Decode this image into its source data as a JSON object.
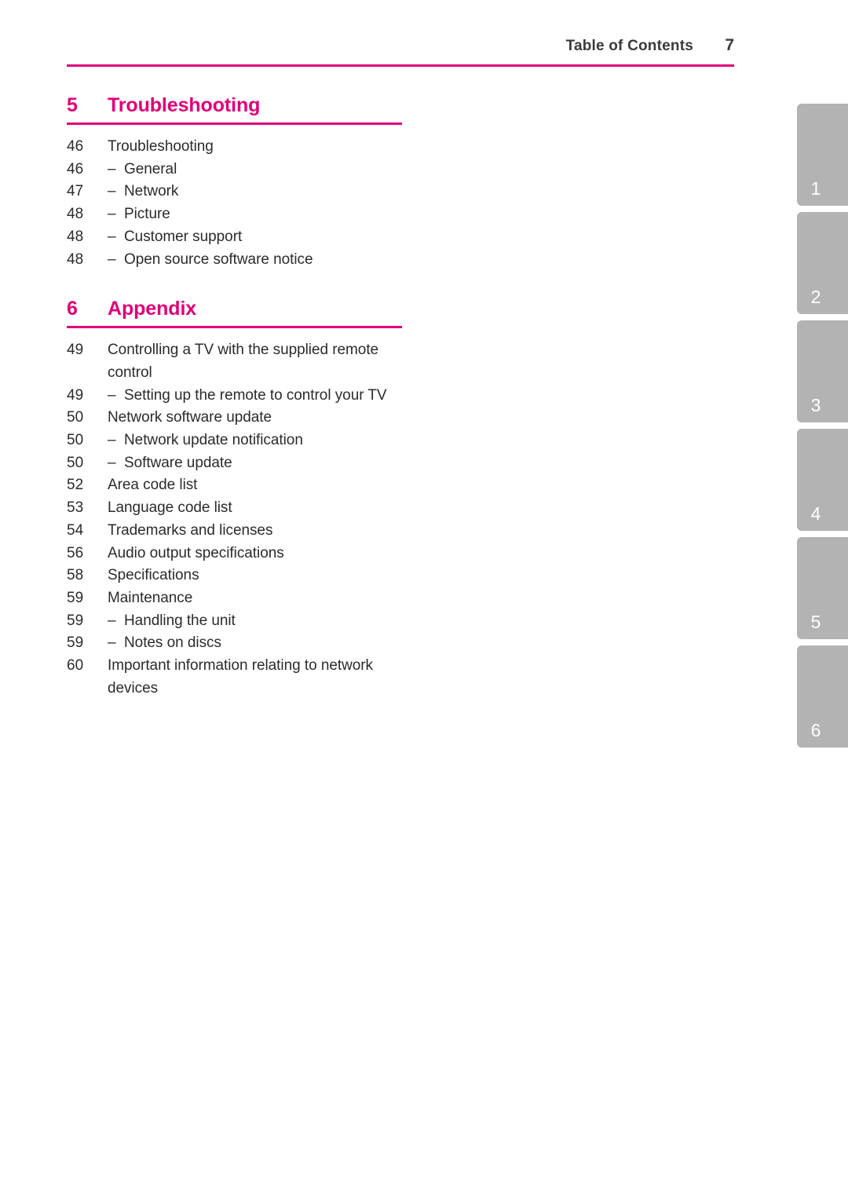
{
  "header": {
    "title": "Table of Contents",
    "page_number": "7",
    "rule_color": "#e0007a"
  },
  "theme": {
    "accent_color": "#e0007a",
    "text_color": "#2b2b2b",
    "tab_color": "#b3b3b3",
    "tab_label_color": "#ffffff"
  },
  "chapters": [
    {
      "number": "5",
      "title": "Troubleshooting",
      "entries": [
        {
          "page": "46",
          "dash": "",
          "text": "Troubleshooting",
          "level": 1
        },
        {
          "page": "46",
          "dash": "–",
          "text": "General",
          "level": 2
        },
        {
          "page": "47",
          "dash": "–",
          "text": "Network",
          "level": 2
        },
        {
          "page": "48",
          "dash": "–",
          "text": "Picture",
          "level": 2
        },
        {
          "page": "48",
          "dash": "–",
          "text": "Customer support",
          "level": 2
        },
        {
          "page": "48",
          "dash": "–",
          "text": "Open source software notice",
          "level": 2
        }
      ]
    },
    {
      "number": "6",
      "title": "Appendix",
      "entries": [
        {
          "page": "49",
          "dash": "",
          "text": "Controlling a TV with the supplied remote control",
          "level": 1
        },
        {
          "page": "49",
          "dash": "–",
          "text": "Setting up the remote to control your TV",
          "level": 2
        },
        {
          "page": "50",
          "dash": "",
          "text": "Network software update",
          "level": 1
        },
        {
          "page": "50",
          "dash": "–",
          "text": "Network update notification",
          "level": 2
        },
        {
          "page": "50",
          "dash": "–",
          "text": "Software update",
          "level": 2
        },
        {
          "page": "52",
          "dash": "",
          "text": "Area code list",
          "level": 1
        },
        {
          "page": "53",
          "dash": "",
          "text": "Language code list",
          "level": 1
        },
        {
          "page": "54",
          "dash": "",
          "text": "Trademarks and licenses",
          "level": 1
        },
        {
          "page": "56",
          "dash": "",
          "text": "Audio output specifications",
          "level": 1
        },
        {
          "page": "58",
          "dash": "",
          "text": "Specifications",
          "level": 1
        },
        {
          "page": "59",
          "dash": "",
          "text": "Maintenance",
          "level": 1
        },
        {
          "page": "59",
          "dash": "–",
          "text": "Handling the unit",
          "level": 2
        },
        {
          "page": "59",
          "dash": "–",
          "text": "Notes on discs",
          "level": 2
        },
        {
          "page": "60",
          "dash": "",
          "text": "Important information relating to network devices",
          "level": 1
        }
      ]
    }
  ],
  "chapter_tabs": [
    {
      "label": "1"
    },
    {
      "label": "2"
    },
    {
      "label": "3"
    },
    {
      "label": "4"
    },
    {
      "label": "5"
    },
    {
      "label": "6"
    }
  ]
}
